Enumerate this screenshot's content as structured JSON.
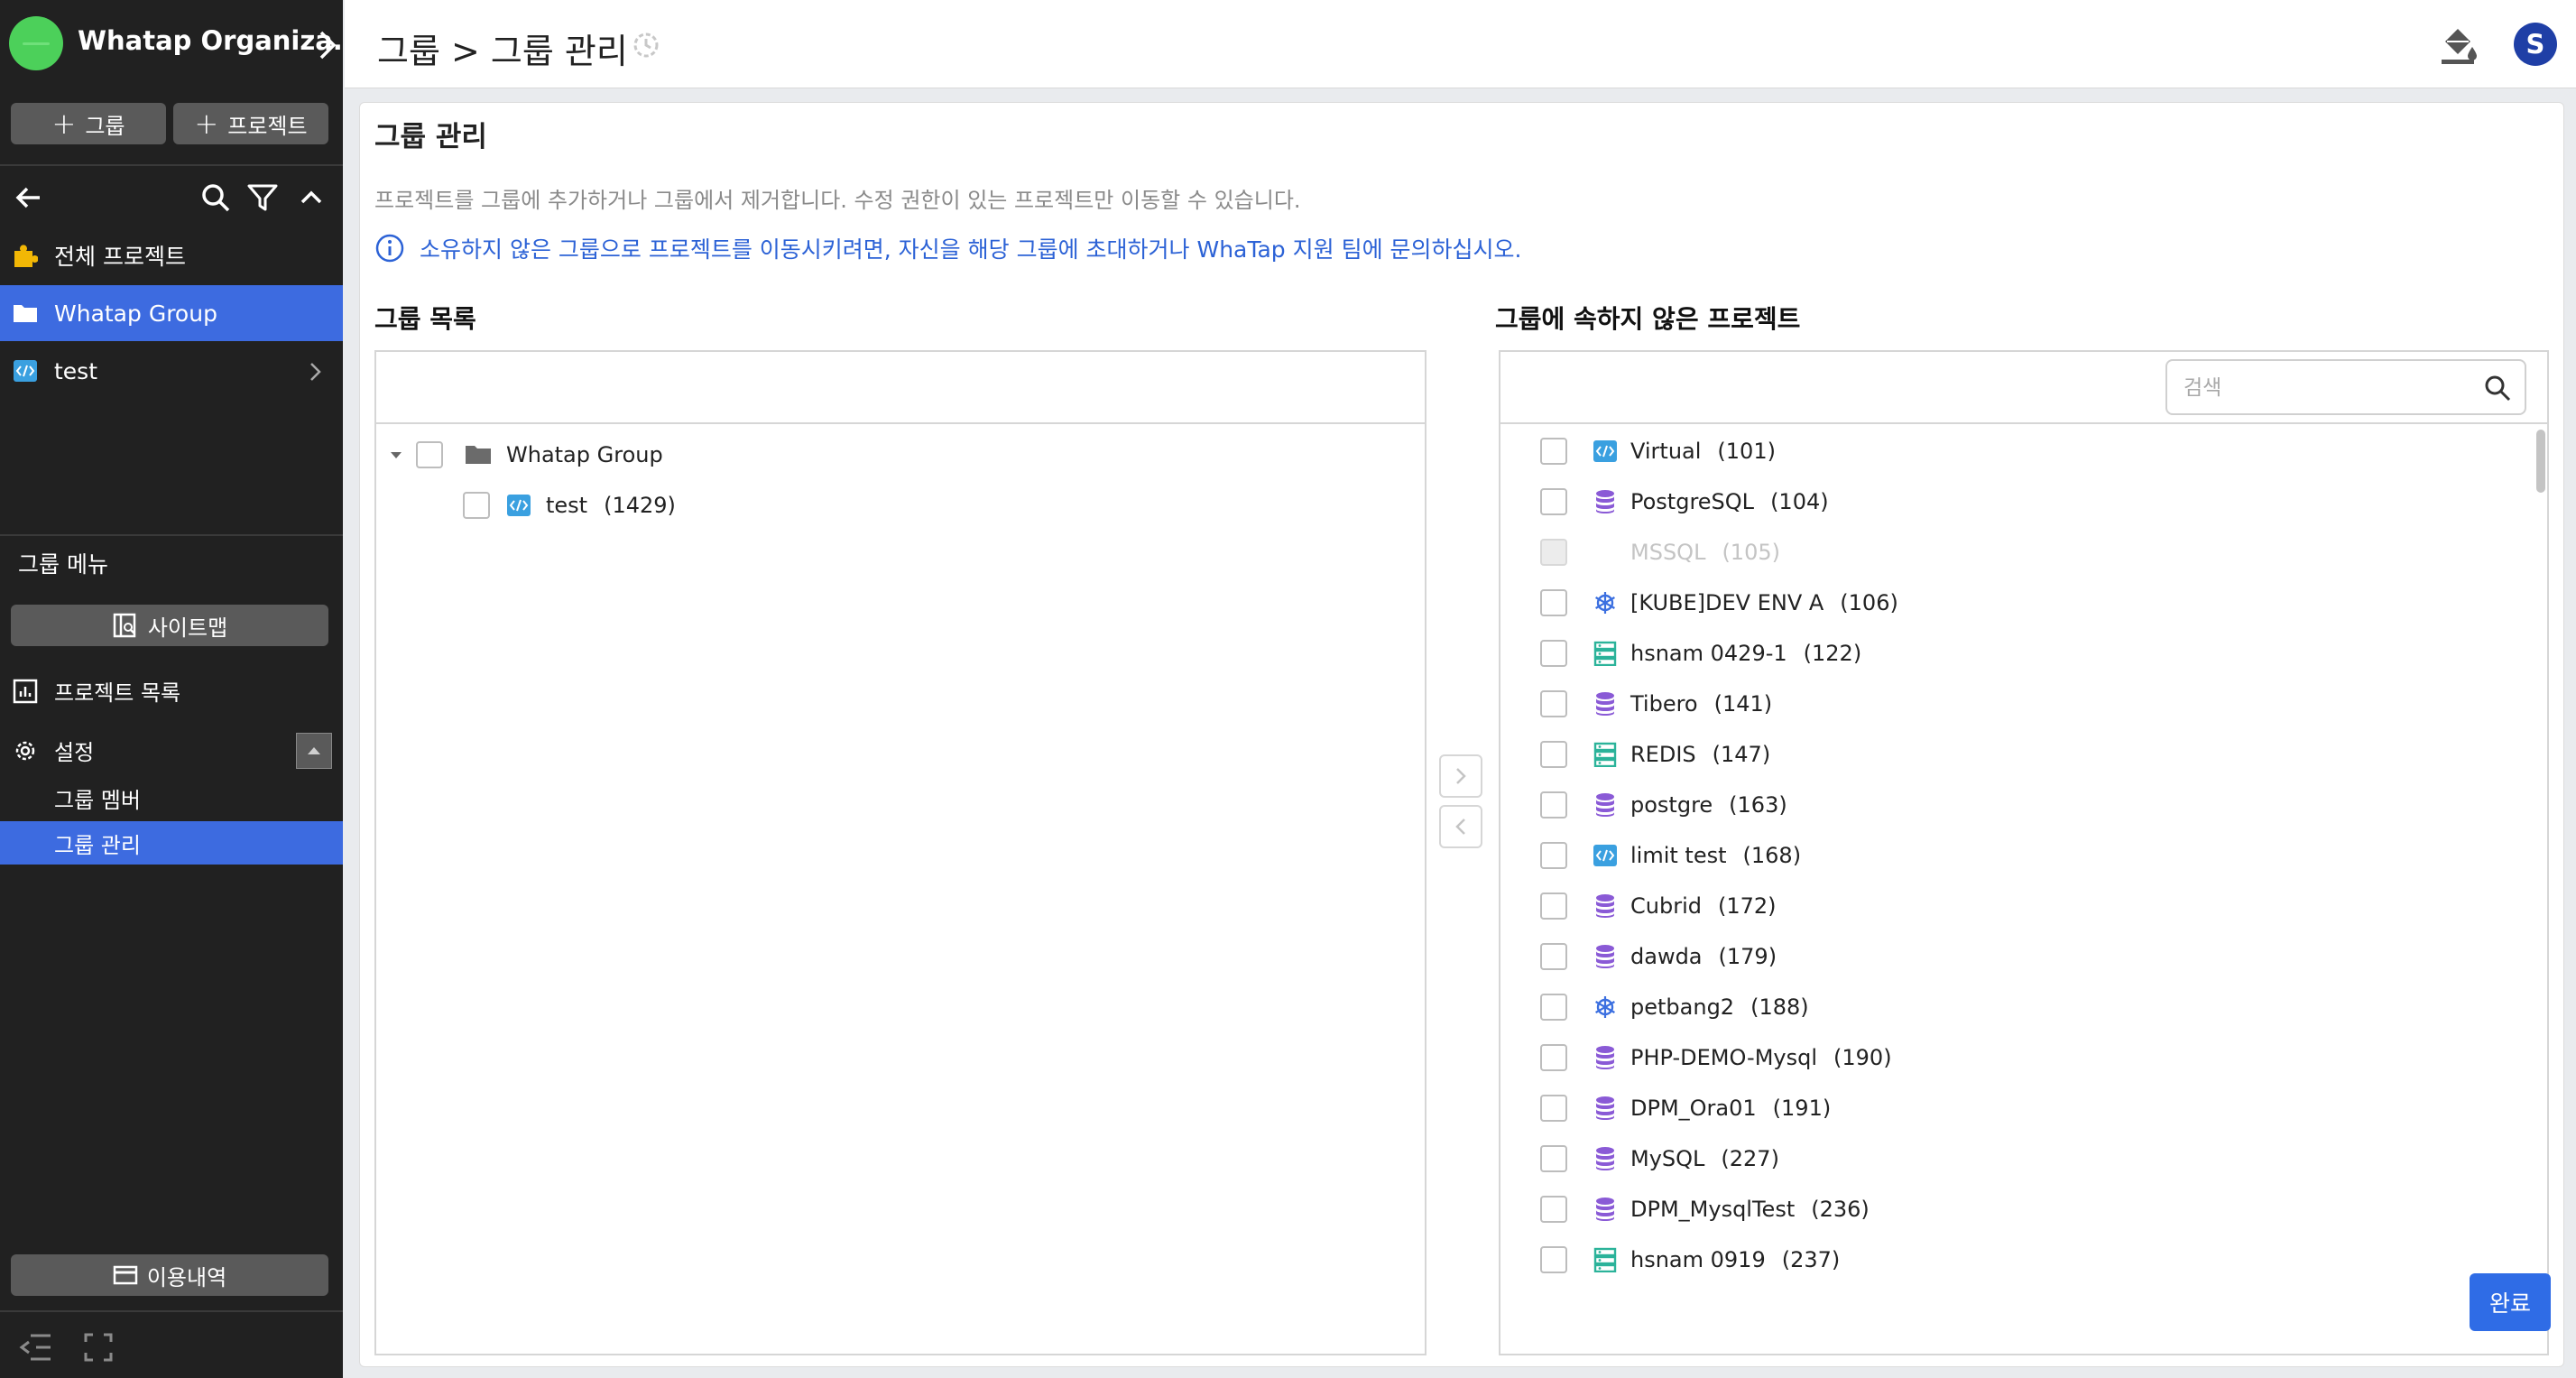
{
  "org": {
    "name": "Whatap Organiza..."
  },
  "sidebar": {
    "add_group_label": "그룹",
    "add_project_label": "프로젝트",
    "nav": [
      {
        "label": "전체 프로젝트",
        "icon": "puzzle-icon"
      },
      {
        "label": "Whatap Group",
        "icon": "folder-icon"
      },
      {
        "label": "test",
        "icon": "code-icon"
      }
    ],
    "group_menu_title": "그룹 메뉴",
    "sitemap_label": "사이트맵",
    "menu": [
      {
        "label": "프로젝트 목록",
        "icon": "chart-icon"
      },
      {
        "label": "설정",
        "icon": "gear-icon"
      },
      {
        "label": "그룹 멤버"
      },
      {
        "label": "그룹 관리"
      }
    ],
    "usage_label": "이용내역"
  },
  "header": {
    "breadcrumb": "그룹 > 그룹 관리",
    "user_initial": "S"
  },
  "page": {
    "title": "그룹 관리",
    "description": "프로젝트를 그룹에 추가하거나 그룹에서 제거합니다. 수정 권한이 있는 프로젝트만 이동할 수 있습니다.",
    "info": "소유하지 않은 그룹으로 프로젝트를 이동시키려면, 자신을 해당 그룹에 초대하거나 WhaTap 지원 팀에 문의하십시오.",
    "done_label": "완료"
  },
  "group_list": {
    "title": "그룹 목록",
    "group": {
      "name": "Whatap Group"
    },
    "children": [
      {
        "name": "test",
        "count": "(1429)",
        "icon": "code-icon"
      }
    ]
  },
  "ungrouped": {
    "title": "그룹에 속하지 않은 프로젝트",
    "search_placeholder": "검색",
    "projects": [
      {
        "name": "Virtual",
        "count": "(101)",
        "icon": "code-icon"
      },
      {
        "name": "PostgreSQL",
        "count": "(104)",
        "icon": "database-icon"
      },
      {
        "name": "MSSQL",
        "count": "(105)",
        "icon": "database-icon",
        "disabled": true
      },
      {
        "name": "[KUBE]DEV ENV A",
        "count": "(106)",
        "icon": "kubernetes-icon"
      },
      {
        "name": "hsnam 0429-1",
        "count": "(122)",
        "icon": "server-icon"
      },
      {
        "name": "Tibero",
        "count": "(141)",
        "icon": "database-icon"
      },
      {
        "name": "REDIS",
        "count": "(147)",
        "icon": "server-icon"
      },
      {
        "name": "postgre",
        "count": "(163)",
        "icon": "database-icon"
      },
      {
        "name": "limit test",
        "count": "(168)",
        "icon": "code-icon"
      },
      {
        "name": "Cubrid",
        "count": "(172)",
        "icon": "database-icon"
      },
      {
        "name": "dawda",
        "count": "(179)",
        "icon": "database-icon"
      },
      {
        "name": "petbang2",
        "count": "(188)",
        "icon": "kubernetes-icon"
      },
      {
        "name": "PHP-DEMO-Mysql",
        "count": "(190)",
        "icon": "database-icon"
      },
      {
        "name": "DPM_Ora01",
        "count": "(191)",
        "icon": "database-icon"
      },
      {
        "name": "MySQL",
        "count": "(227)",
        "icon": "database-icon"
      },
      {
        "name": "DPM_MysqlTest",
        "count": "(236)",
        "icon": "database-icon"
      },
      {
        "name": "hsnam 0919",
        "count": "(237)",
        "icon": "server-icon"
      }
    ]
  },
  "colors": {
    "accent": "#3d6be0",
    "sidebar_bg": "#212121",
    "info_text": "#2c62d6",
    "db_icon": "#8a5ad6",
    "server_icon": "#2bb39a",
    "code_icon": "#3aa0e0",
    "kube_icon": "#3b6fe0",
    "folder": "#6b6b6b",
    "puzzle": "#f2b705"
  }
}
